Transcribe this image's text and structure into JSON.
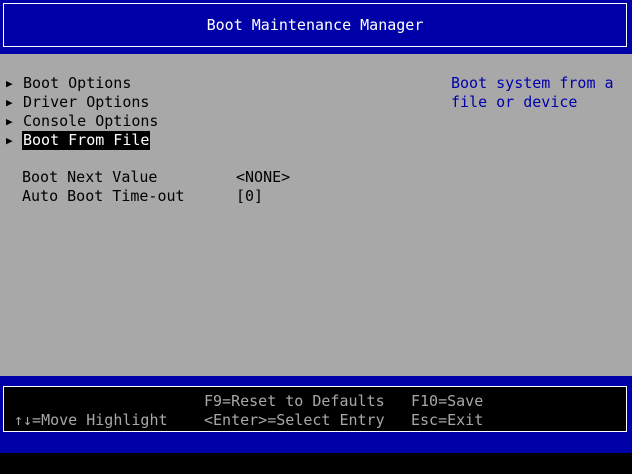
{
  "header": {
    "title": "Boot Maintenance Manager"
  },
  "menu": {
    "items": [
      {
        "label": "Boot Options",
        "arrow_icon": "right-triangle",
        "selected": false
      },
      {
        "label": "Driver Options",
        "arrow_icon": "right-triangle",
        "selected": false
      },
      {
        "label": "Console Options",
        "arrow_icon": "right-triangle",
        "selected": false
      },
      {
        "label": "Boot From File",
        "arrow_icon": "right-triangle",
        "selected": true
      }
    ]
  },
  "settings": {
    "boot_next_label": "Boot Next Value",
    "boot_next_value": "<NONE>",
    "auto_boot_label": "Auto Boot Time-out",
    "auto_boot_value": "[0]"
  },
  "help": {
    "text": "Boot system from a file or device"
  },
  "footer": {
    "reset": "F9=Reset to Defaults",
    "save": "F10=Save",
    "move": "↑↓=Move Highlight",
    "select": "<Enter>=Select Entry",
    "exit": "Esc=Exit"
  },
  "colors": {
    "blue": "#0000a8",
    "gray": "#a8a8a8",
    "black": "#000000",
    "white": "#ffffff"
  }
}
